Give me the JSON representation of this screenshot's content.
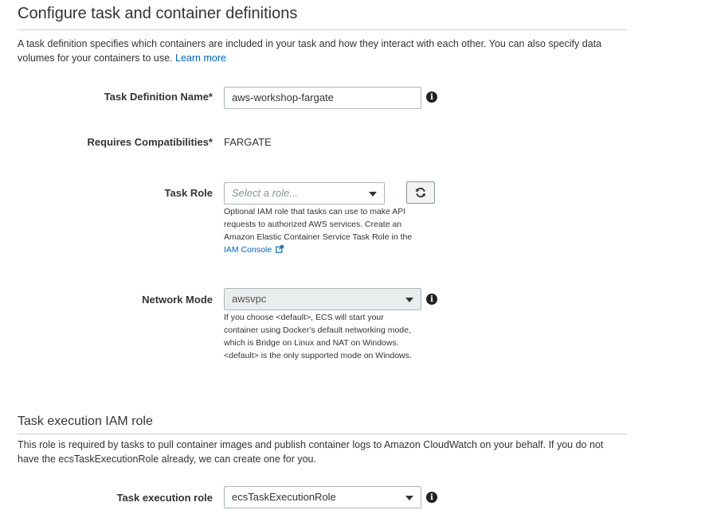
{
  "section1": {
    "title": "Configure task and container definitions",
    "description": "A task definition specifies which containers are included in your task and how they interact with each other. You can also specify data volumes for your containers to use.",
    "learn_more": "Learn more"
  },
  "fields": {
    "task_definition_name": {
      "label": "Task Definition Name*",
      "value": "aws-workshop-fargate"
    },
    "requires_compatibilities": {
      "label": "Requires Compatibilities*",
      "value": "FARGATE"
    },
    "task_role": {
      "label": "Task Role",
      "placeholder": "Select a role...",
      "help_lines": [
        "Optional IAM role that tasks can use to make API",
        "requests to authorized AWS services. Create an",
        "Amazon Elastic Container Service Task Role in the"
      ],
      "help_link": "IAM Console"
    },
    "network_mode": {
      "label": "Network Mode",
      "value": "awsvpc",
      "help_lines": [
        "If you choose <default>, ECS will start your",
        "container using Docker's default networking mode,",
        "which is Bridge on Linux and NAT on Windows.",
        "<default> is the only supported mode on Windows."
      ]
    }
  },
  "section2": {
    "title": "Task execution IAM role",
    "description": "This role is required by tasks to pull container images and publish container logs to Amazon CloudWatch on your behalf. If you do not have the ecsTaskExecutionRole already, we can create one for you."
  },
  "task_execution_role": {
    "label": "Task execution role",
    "value": "ecsTaskExecutionRole"
  },
  "icons": {
    "info": "info-icon",
    "refresh": "refresh-icon",
    "external_link": "external-link-icon"
  },
  "colors": {
    "link": "#0066bb",
    "disabled_bg": "#eaeded"
  }
}
